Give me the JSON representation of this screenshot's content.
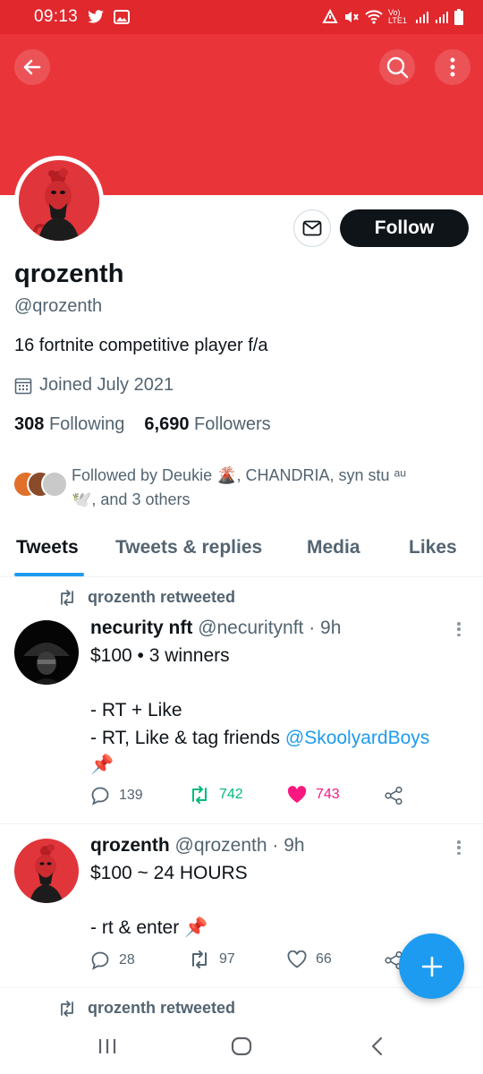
{
  "status_bar": {
    "time": "09:13",
    "network_label": "Vo) LTE1",
    "colors": {
      "background": "#e0282d"
    }
  },
  "header": {
    "banner_color": "#e9353a",
    "icons": [
      "back-arrow-icon",
      "search-icon",
      "more-vertical-icon"
    ]
  },
  "profile": {
    "display_name": "qrozenth",
    "handle": "@qrozenth",
    "bio": "16 fortnite competitive player f/a",
    "joined": "Joined July 2021",
    "following_count": "308",
    "following_label": "Following",
    "followers_count": "6,690",
    "followers_label": "Followers",
    "follow_button": "Follow",
    "followed_by_line1": "Followed by Deukie 🌋, CHANDRIA, syn stu ᵃᵘ",
    "followed_by_line2": "🕊️, and 3 others"
  },
  "tabs": [
    {
      "label": "Tweets",
      "active": true
    },
    {
      "label": "Tweets & replies",
      "active": false
    },
    {
      "label": "Media",
      "active": false
    },
    {
      "label": "Likes",
      "active": false
    }
  ],
  "tweets": [
    {
      "retweeted_by": "qrozenth retweeted",
      "name": "necurity nft",
      "meta": "@necuritynft · 9h",
      "body_text": "$100 • 3 winners\n\n- RT + Like\n- RT, Like & tag friends ",
      "mention": "@SkoolyardBoys",
      "body_end": "\n📌",
      "replies": "139",
      "retweets": "742",
      "likes": "743"
    },
    {
      "name": "qrozenth",
      "meta": "@qrozenth · 9h",
      "body_text": "$100 ~ 24 HOURS\n\n- rt & enter 📌",
      "replies": "28",
      "retweets": "97",
      "likes": "66"
    },
    {
      "retweeted_by": "qrozenth retweeted"
    }
  ],
  "colors": {
    "accent": "#1d9bf0",
    "text_primary": "#0f1419",
    "text_secondary": "#536471",
    "retweet_green": "#00ba7c",
    "like_pink": "#f91880"
  }
}
